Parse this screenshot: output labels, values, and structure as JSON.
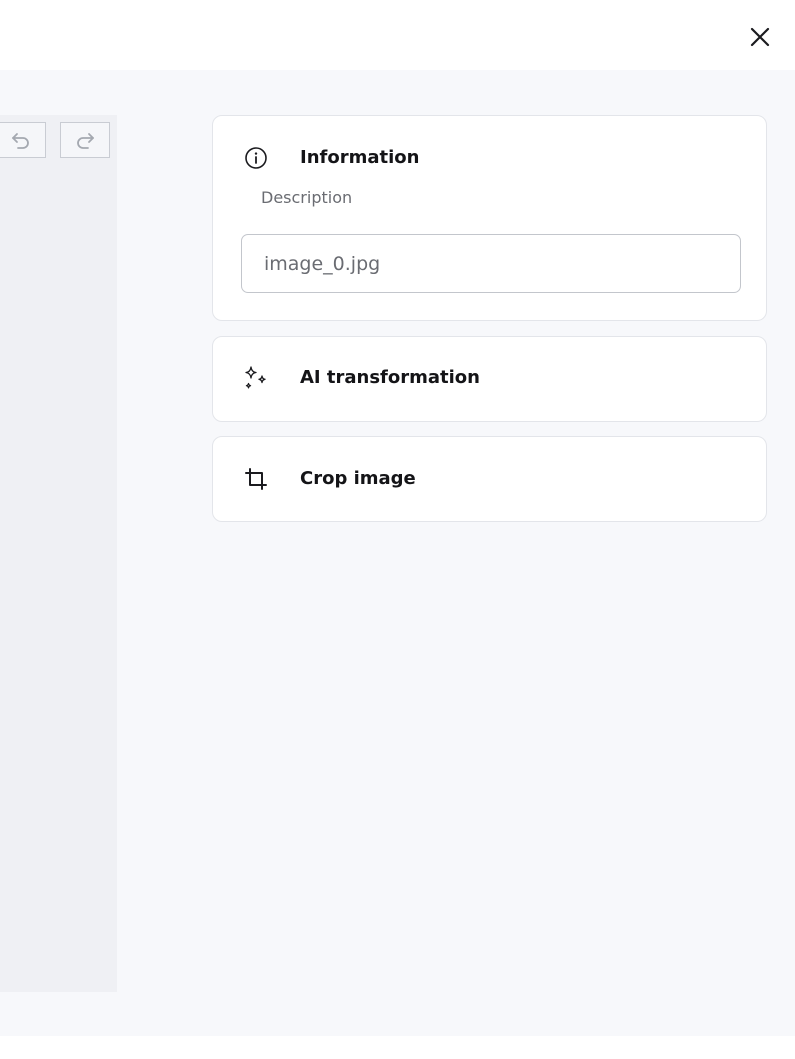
{
  "header": {
    "close_icon": "close-icon"
  },
  "toolbar": {
    "undo_icon": "undo-icon",
    "redo_icon": "redo-icon"
  },
  "panels": {
    "information": {
      "icon": "info-circle-icon",
      "title": "Information",
      "description_label": "Description",
      "description_value": "image_0.jpg"
    },
    "ai_transformation": {
      "icon": "sparkles-icon",
      "title": "AI transformation"
    },
    "crop_image": {
      "icon": "crop-icon",
      "title": "Crop image"
    }
  },
  "colors": {
    "body_bg": "#f7f8fb",
    "canvas_bg": "#eff0f4",
    "panel_border": "#e3e5ea",
    "text_primary": "#141417",
    "text_muted": "#6a6c72"
  }
}
